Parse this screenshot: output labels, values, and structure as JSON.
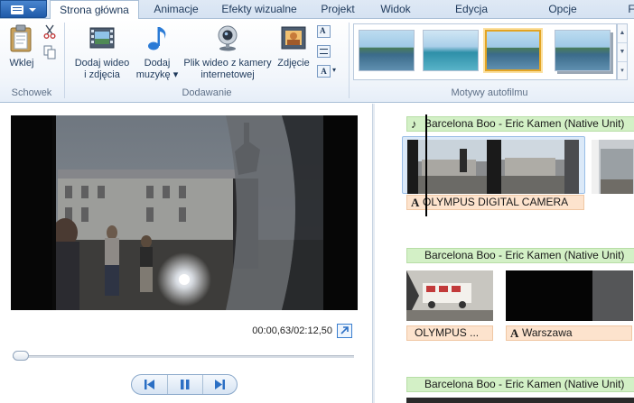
{
  "ribbon": {
    "tabs": [
      {
        "label": "Strona główna",
        "active": true
      },
      {
        "label": "Animacje"
      },
      {
        "label": "Efekty wizualne"
      },
      {
        "label": "Projekt"
      },
      {
        "label": "Widok"
      },
      {
        "label": "Edycja"
      },
      {
        "label": "Opcje"
      },
      {
        "label": "F"
      }
    ],
    "groups": {
      "clipboard": {
        "label": "Schowek",
        "paste_label": "Wklej"
      },
      "add": {
        "label": "Dodawanie",
        "add_video_line1": "Dodaj wideo",
        "add_video_line2": "i zdjęcia",
        "add_music_line1": "Dodaj",
        "add_music_line2": "muzykę",
        "webcam_line1": "Plik wideo z kamery",
        "webcam_line2": "internetowej",
        "photo_label": "Zdjęcie"
      },
      "automovie": {
        "label": "Motywy autofilmu"
      }
    }
  },
  "preview": {
    "timecode": "00:00,63/02:12,50",
    "position_fraction": 0.005
  },
  "storyboard": {
    "music_1": "Barcelona Boo - Eric Kamen (Native Unit)",
    "caption_1": "OLYMPUS DIGITAL CAMERA",
    "music_2": "Barcelona Boo - Eric Kamen (Native Unit)",
    "caption_2a": "OLYMPUS ...",
    "caption_2b": "Warszawa",
    "music_3": "Barcelona Boo - Eric Kamen (Native Unit)"
  },
  "colors": {
    "ribbon_tab_bg": "#dfe9f5",
    "music_bar": "#d3f0c6",
    "caption_bar": "#fde3cd",
    "gallery_selected": "#e3a423"
  },
  "icons": [
    "menu-icon",
    "paste-icon",
    "cut-icon",
    "copy-icon",
    "film-icon",
    "music-note-icon",
    "webcam-icon",
    "photo-icon",
    "fullscreen-icon",
    "prev-frame-icon",
    "pause-icon",
    "next-frame-icon",
    "text-icon"
  ]
}
